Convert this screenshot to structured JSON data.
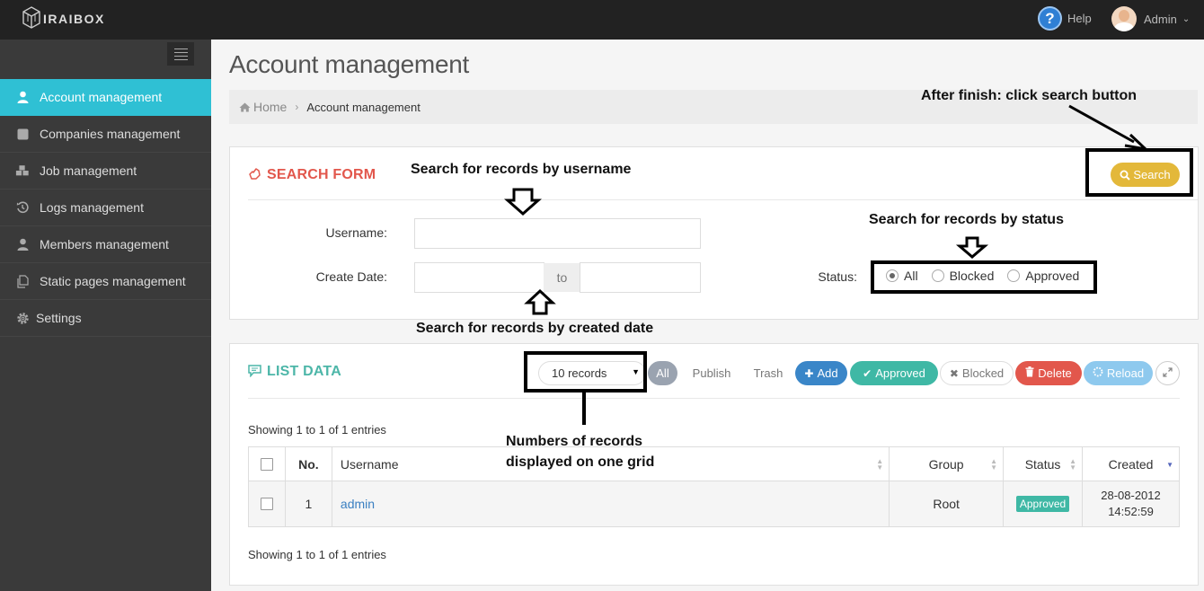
{
  "header": {
    "logo_text": "IRAIBOX",
    "help_label": "Help",
    "user_name": "Admin"
  },
  "sidebar": {
    "items": [
      {
        "label": "Account management",
        "icon": "user-icon",
        "active": true
      },
      {
        "label": "Companies management",
        "icon": "building-icon"
      },
      {
        "label": "Job management",
        "icon": "cubes-icon"
      },
      {
        "label": "Logs management",
        "icon": "history-icon"
      },
      {
        "label": "Members management",
        "icon": "user-icon"
      },
      {
        "label": "Static pages management",
        "icon": "copy-icon"
      },
      {
        "label": "Settings",
        "icon": "gear-icon"
      }
    ]
  },
  "page": {
    "title": "Account management",
    "breadcrumb": {
      "home": "Home",
      "current": "Account management"
    }
  },
  "search_form": {
    "title": "SEARCH FORM",
    "search_button": "Search",
    "username_label": "Username:",
    "username_value": "",
    "create_date_label": "Create Date:",
    "date_from_value": "",
    "date_to_value": "",
    "date_separator": "to",
    "status_label": "Status:",
    "status_options": [
      "All",
      "Blocked",
      "Approved"
    ],
    "status_selected": "All"
  },
  "list_data": {
    "title": "LIST DATA",
    "records_select": "10 records",
    "filters": [
      "All",
      "Publish",
      "Trash"
    ],
    "actions": {
      "add": "Add",
      "approved": "Approved",
      "blocked": "Blocked",
      "delete": "Delete",
      "reload": "Reload"
    },
    "showing_top": "Showing 1 to 1 of 1 entries",
    "showing_bottom": "Showing 1 to 1 of 1 entries",
    "columns": [
      "No.",
      "Username",
      "Group",
      "Status",
      "Created"
    ],
    "rows": [
      {
        "no": "1",
        "username": "admin",
        "group": "Root",
        "status": "Approved",
        "created_date": "28-08-2012",
        "created_time": "14:52:59"
      }
    ]
  },
  "annotations": {
    "search_button_note": "After finish: click search button",
    "username_note": "Search for records by username",
    "status_note": "Search for records by status",
    "date_note": "Search for records by created date",
    "records_note_line1": "Numbers of records",
    "records_note_line2": "displayed on one grid"
  },
  "colors": {
    "accent": "#2fc0d4",
    "search_title": "#e2574c",
    "list_title": "#4cb6a8",
    "search_button": "#e3b83a",
    "add": "#3a86c8",
    "approved": "#3fb8a5",
    "delete": "#e2574c",
    "reload": "#8ec9ee"
  }
}
